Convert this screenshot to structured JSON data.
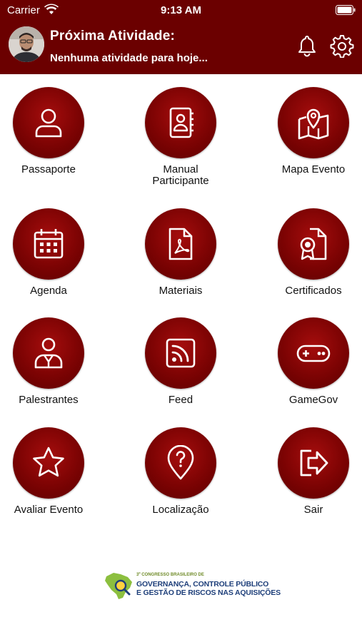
{
  "status_bar": {
    "carrier": "Carrier",
    "time": "9:13 AM"
  },
  "header": {
    "title": "Próxima Atividade:",
    "subtitle": "Nenhuma atividade para hoje..."
  },
  "menu": [
    {
      "icon": "person-icon",
      "lines": [
        "Passaporte"
      ]
    },
    {
      "icon": "contact-book-icon",
      "lines": [
        "Manual",
        "Participante"
      ]
    },
    {
      "icon": "map-pin-icon",
      "lines": [
        "Mapa Evento"
      ]
    },
    {
      "icon": "calendar-icon",
      "lines": [
        "Agenda"
      ]
    },
    {
      "icon": "pdf-file-icon",
      "lines": [
        "Materiais"
      ]
    },
    {
      "icon": "certificate-icon",
      "lines": [
        "Certificados"
      ]
    },
    {
      "icon": "speaker-icon",
      "lines": [
        "Palestrantes"
      ]
    },
    {
      "icon": "rss-feed-icon",
      "lines": [
        "Feed"
      ]
    },
    {
      "icon": "gamepad-icon",
      "lines": [
        "GameGov"
      ]
    },
    {
      "icon": "star-icon",
      "lines": [
        "Avaliar Evento"
      ]
    },
    {
      "icon": "location-help-icon",
      "lines": [
        "Localização"
      ]
    },
    {
      "icon": "exit-icon",
      "lines": [
        "Sair"
      ]
    }
  ],
  "footer": {
    "small": "3º CONGRESSO BRASILEIRO DE",
    "line1": "GOVERNANÇA, CONTROLE PÚBLICO",
    "line2": "E GESTÃO DE RISCOS NAS AQUISIÇÕES"
  },
  "colors": {
    "brand": "#6b0000",
    "circle": "#8a0606"
  }
}
